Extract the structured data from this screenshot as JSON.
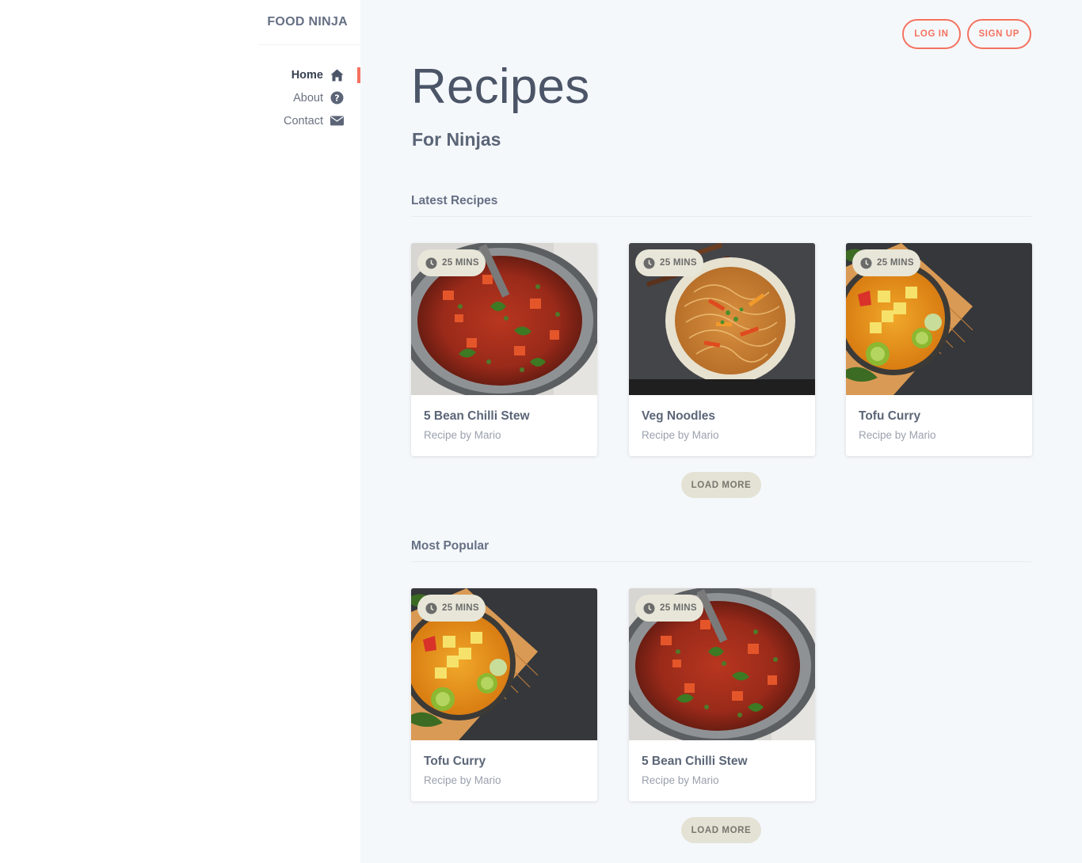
{
  "brand": "FOOD NINJA",
  "nav": [
    {
      "label": "Home",
      "icon": "home-icon",
      "active": true
    },
    {
      "label": "About",
      "icon": "question-circle-icon",
      "active": false
    },
    {
      "label": "Contact",
      "icon": "envelope-icon",
      "active": false
    }
  ],
  "auth": {
    "login": "LOG IN",
    "signup": "SIGN UP"
  },
  "hero": {
    "title": "Recipes",
    "subtitle": "For Ninjas"
  },
  "latest": {
    "title": "Latest Recipes",
    "load_more": "LOAD MORE",
    "cards": [
      {
        "time": "25 MINS",
        "title": "5 Bean Chilli Stew",
        "author": "Recipe by Mario",
        "image": "chilli-stew"
      },
      {
        "time": "25 MINS",
        "title": "Veg Noodles",
        "author": "Recipe by Mario",
        "image": "veg-noodles"
      },
      {
        "time": "25 MINS",
        "title": "Tofu Curry",
        "author": "Recipe by Mario",
        "image": "tofu-curry"
      }
    ]
  },
  "popular": {
    "title": "Most Popular",
    "load_more": "LOAD MORE",
    "cards": [
      {
        "time": "25 MINS",
        "title": "Tofu Curry",
        "author": "Recipe by Mario",
        "image": "tofu-curry"
      },
      {
        "time": "25 MINS",
        "title": "5 Bean Chilli Stew",
        "author": "Recipe by Mario",
        "image": "chilli-stew"
      }
    ]
  },
  "colors": {
    "accent": "#f4725f",
    "badge": "#e7e6d8",
    "main_bg": "#f5f8fb",
    "text": "#4b5567"
  }
}
